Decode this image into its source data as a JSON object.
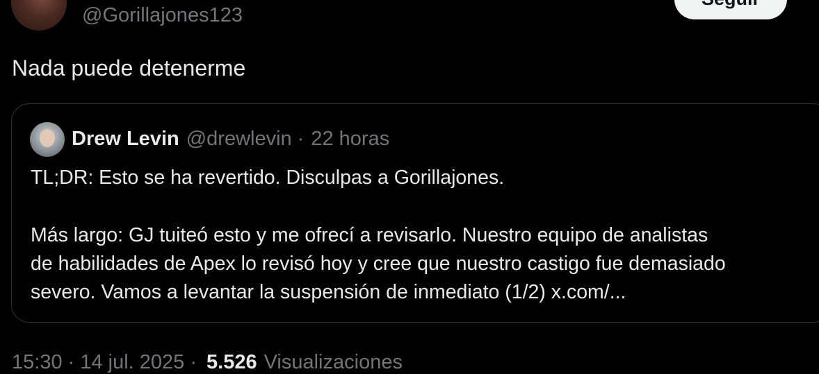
{
  "tweet": {
    "handle": "@Gorillajones123",
    "follow_label": "Seguir",
    "text": "Nada puede detenerme"
  },
  "quote": {
    "name": "Drew Levin",
    "handle": "@drewlevin",
    "separator": "·",
    "time": "22 horas",
    "lines": [
      "TL;DR: Esto se ha revertido. Disculpas a Gorillajones.",
      "Más largo: GJ tuiteó esto y me ofrecí a revisarlo. Nuestro equipo de analistas",
      "de habilidades de Apex lo revisó hoy y cree que nuestro castigo fue demasiado",
      "severo. Vamos a levantar la suspensión de inmediato (1/2) x.com/..."
    ]
  },
  "meta": {
    "timestamp": "15:30 · 14 jul. 2025 ·",
    "views_count": "5.526",
    "views_label": "Visualizaciones"
  }
}
